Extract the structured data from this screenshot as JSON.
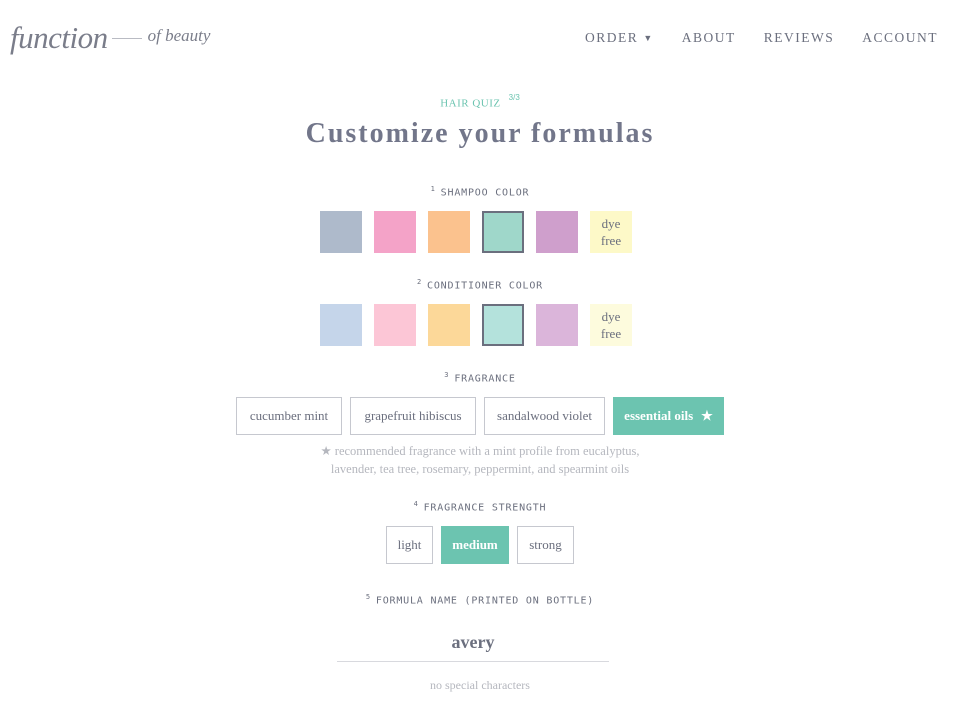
{
  "header": {
    "logo_main": "function",
    "logo_sub": "of beauty",
    "nav": [
      {
        "label": "ORDER",
        "has_caret": true
      },
      {
        "label": "ABOUT"
      },
      {
        "label": "REVIEWS"
      },
      {
        "label": "ACCOUNT"
      }
    ],
    "caret_icon": "caret-down-icon"
  },
  "quiz": {
    "tag": "HAIR QUIZ",
    "step": "3/3",
    "title": "Customize your formulas"
  },
  "shampoo": {
    "num": "1",
    "label": "SHAMPOO COLOR",
    "swatches": [
      {
        "color": "#aebacb",
        "selected": false
      },
      {
        "color": "#f4a3c8",
        "selected": false
      },
      {
        "color": "#fbc28e",
        "selected": false
      },
      {
        "color": "#9fd7ca",
        "selected": true
      },
      {
        "color": "#cf9fcc",
        "selected": false
      }
    ],
    "dye_free": {
      "line1": "dye",
      "line2": "free",
      "color": "#fdf9c8"
    }
  },
  "conditioner": {
    "num": "2",
    "label": "CONDITIONER COLOR",
    "swatches": [
      {
        "color": "#c5d5ea",
        "selected": false
      },
      {
        "color": "#fcc6d6",
        "selected": false
      },
      {
        "color": "#fcd899",
        "selected": false
      },
      {
        "color": "#b4e2dc",
        "selected": true
      },
      {
        "color": "#dbb5da",
        "selected": false
      }
    ],
    "dye_free": {
      "line1": "dye",
      "line2": "free",
      "color": "#fdfbdd"
    }
  },
  "fragrance": {
    "num": "3",
    "label": "FRAGRANCE",
    "options": [
      {
        "label": "cucumber mint",
        "active": false
      },
      {
        "label": "grapefruit hibiscus",
        "active": false
      },
      {
        "label": "sandalwood violet",
        "active": false
      },
      {
        "label": "essential oils",
        "active": true,
        "star": "★"
      }
    ],
    "note_star": "★",
    "note_line1": "recommended fragrance with a mint profile from eucalyptus,",
    "note_line2": "lavender, tea tree, rosemary, peppermint, and spearmint oils"
  },
  "strength": {
    "num": "4",
    "label": "FRAGRANCE STRENGTH",
    "options": [
      {
        "label": "light",
        "active": false
      },
      {
        "label": "medium",
        "active": true
      },
      {
        "label": "strong",
        "active": false
      }
    ]
  },
  "formula_name": {
    "num": "5",
    "label": "FORMULA NAME (PRINTED ON BOTTLE)",
    "value": "avery",
    "hint": "no special characters"
  },
  "colors": {
    "accent": "#6cc4b0",
    "text": "#6b6f7e",
    "muted": "#b5b7be"
  }
}
